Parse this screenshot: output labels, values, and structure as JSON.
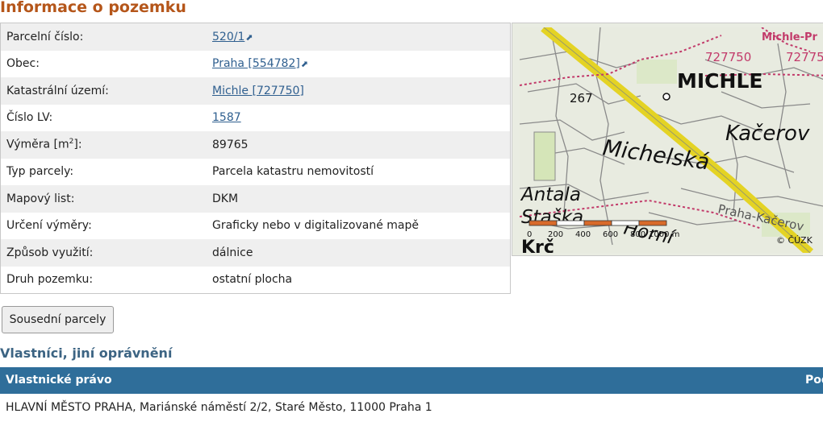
{
  "page_title": "Informace o pozemku",
  "parcel": {
    "rows": [
      {
        "label": "Parcelní číslo:",
        "value": "520/1",
        "link": true,
        "external_icon": "external-link-icon"
      },
      {
        "label": "Obec:",
        "value": "Praha [554782]",
        "link": true,
        "external_icon": "external-link-icon"
      },
      {
        "label": "Katastrální území:",
        "value": "Michle [727750]",
        "link": true
      },
      {
        "label": "Číslo LV:",
        "value": "1587",
        "link": true
      },
      {
        "label_main": "Výměra [m",
        "label_sup": "2",
        "label_end": "]:",
        "value": "89765"
      },
      {
        "label": "Typ parcely:",
        "value": "Parcela katastru nemovitostí"
      },
      {
        "label": "Mapový list:",
        "value": "DKM"
      },
      {
        "label": "Určení výměry:",
        "value": "Graficky nebo v digitalizované mapě"
      },
      {
        "label": "Způsob využití:",
        "value": "dálnice"
      },
      {
        "label": "Druh pozemku:",
        "value": "ostatní plocha"
      }
    ]
  },
  "map": {
    "labels": {
      "michle": "MICHLE",
      "michle_praha": "Michle-Pr",
      "code1": "727750",
      "code2": "72775",
      "height": "267",
      "michelska": "Michelská",
      "kacerov": "Kačerov",
      "praha_kacerov": "Praha-Kačerov",
      "antala": "Antala",
      "stasku": "Staška",
      "horni": "Horní",
      "krc": "Krč",
      "copyright": "© ČÚZK"
    },
    "scale_labels": [
      "0",
      "200",
      "400",
      "600",
      "800",
      "1000 m"
    ],
    "colors": {
      "highway": "#e4d324",
      "boundary": "#c23a6a",
      "scale": "#d86a2a"
    }
  },
  "neighbors_button": "Sousední parcely",
  "owners": {
    "title": "Vlastníci, jiní oprávnění",
    "header": {
      "col1": "Vlastnické právo",
      "col2": "Pod"
    },
    "rows": [
      "HLAVNÍ MĚSTO PRAHA, Mariánské náměstí 2/2, Staré Město, 11000 Praha 1"
    ]
  }
}
